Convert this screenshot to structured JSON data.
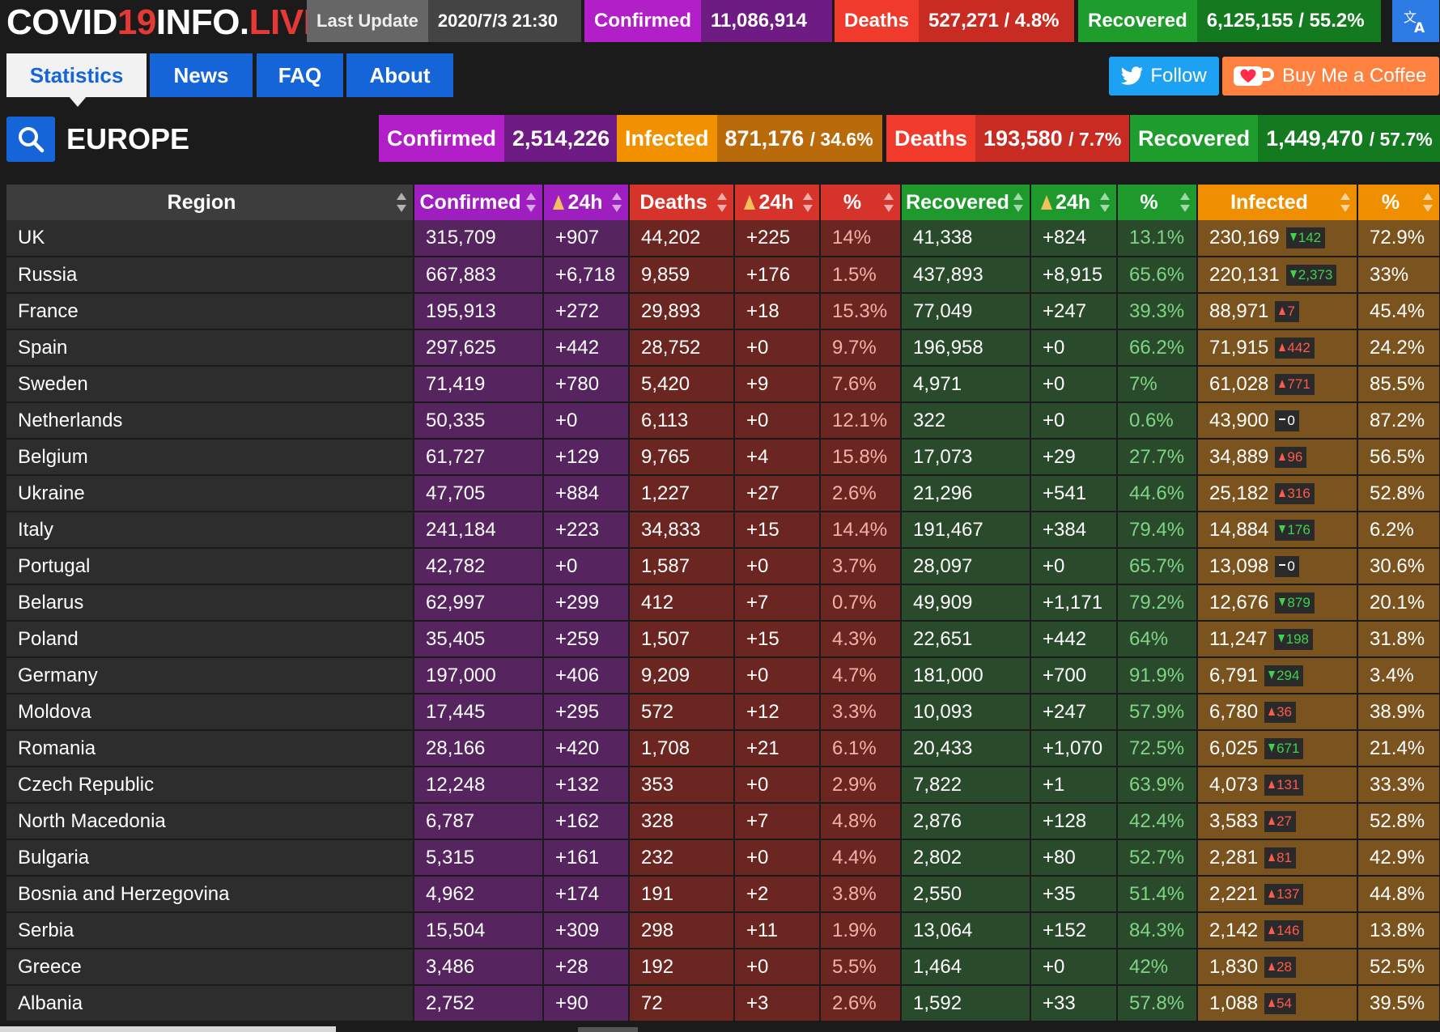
{
  "header": {
    "logo": {
      "part1": "COVID",
      "part2": "19",
      "part3": "INFO.",
      "part4": "LIVE"
    },
    "last_update": {
      "label": "Last Update",
      "value": "2020/7/3 21:30"
    },
    "confirmed": {
      "label": "Confirmed",
      "value": "11,086,914"
    },
    "deaths": {
      "label": "Deaths",
      "value": "527,271",
      "pct": "/ 4.8%"
    },
    "recovered": {
      "label": "Recovered",
      "value": "6,125,155",
      "pct": "/ 55.2%"
    },
    "language_icon": "translate-icon"
  },
  "nav": {
    "tabs": [
      {
        "label": "Statistics",
        "active": true
      },
      {
        "label": "News",
        "active": false
      },
      {
        "label": "FAQ",
        "active": false
      },
      {
        "label": "About",
        "active": false
      }
    ],
    "follow_label": "Follow",
    "coffee_label": "Buy Me a Coffee"
  },
  "region": {
    "name": "EUROPE",
    "confirmed": {
      "label": "Confirmed",
      "value": "2,514,226"
    },
    "infected": {
      "label": "Infected",
      "value": "871,176",
      "pct": "/ 34.6%"
    },
    "deaths": {
      "label": "Deaths",
      "value": "193,580",
      "pct": "/ 7.7%"
    },
    "recovered": {
      "label": "Recovered",
      "value": "1,449,470",
      "pct": "/ 57.7%"
    }
  },
  "table": {
    "columns": [
      "Region",
      "Confirmed",
      "24h",
      "Deaths",
      "24h",
      "%",
      "Recovered",
      "24h",
      "%",
      "Infected",
      "%"
    ],
    "rows": [
      [
        "UK",
        "315,709",
        "+907",
        "44,202",
        "+225",
        "14%",
        "41,338",
        "+824",
        "13.1%",
        "230,169",
        "down",
        "142",
        "72.9%"
      ],
      [
        "Russia",
        "667,883",
        "+6,718",
        "9,859",
        "+176",
        "1.5%",
        "437,893",
        "+8,915",
        "65.6%",
        "220,131",
        "down",
        "2,373",
        "33%"
      ],
      [
        "France",
        "195,913",
        "+272",
        "29,893",
        "+18",
        "15.3%",
        "77,049",
        "+247",
        "39.3%",
        "88,971",
        "up",
        "7",
        "45.4%"
      ],
      [
        "Spain",
        "297,625",
        "+442",
        "28,752",
        "+0",
        "9.7%",
        "196,958",
        "+0",
        "66.2%",
        "71,915",
        "up",
        "442",
        "24.2%"
      ],
      [
        "Sweden",
        "71,419",
        "+780",
        "5,420",
        "+9",
        "7.6%",
        "4,971",
        "+0",
        "7%",
        "61,028",
        "up",
        "771",
        "85.5%"
      ],
      [
        "Netherlands",
        "50,335",
        "+0",
        "6,113",
        "+0",
        "12.1%",
        "322",
        "+0",
        "0.6%",
        "43,900",
        "flat",
        "0",
        "87.2%"
      ],
      [
        "Belgium",
        "61,727",
        "+129",
        "9,765",
        "+4",
        "15.8%",
        "17,073",
        "+29",
        "27.7%",
        "34,889",
        "up",
        "96",
        "56.5%"
      ],
      [
        "Ukraine",
        "47,705",
        "+884",
        "1,227",
        "+27",
        "2.6%",
        "21,296",
        "+541",
        "44.6%",
        "25,182",
        "up",
        "316",
        "52.8%"
      ],
      [
        "Italy",
        "241,184",
        "+223",
        "34,833",
        "+15",
        "14.4%",
        "191,467",
        "+384",
        "79.4%",
        "14,884",
        "down",
        "176",
        "6.2%"
      ],
      [
        "Portugal",
        "42,782",
        "+0",
        "1,587",
        "+0",
        "3.7%",
        "28,097",
        "+0",
        "65.7%",
        "13,098",
        "flat",
        "0",
        "30.6%"
      ],
      [
        "Belarus",
        "62,997",
        "+299",
        "412",
        "+7",
        "0.7%",
        "49,909",
        "+1,171",
        "79.2%",
        "12,676",
        "down",
        "879",
        "20.1%"
      ],
      [
        "Poland",
        "35,405",
        "+259",
        "1,507",
        "+15",
        "4.3%",
        "22,651",
        "+442",
        "64%",
        "11,247",
        "down",
        "198",
        "31.8%"
      ],
      [
        "Germany",
        "197,000",
        "+406",
        "9,209",
        "+0",
        "4.7%",
        "181,000",
        "+700",
        "91.9%",
        "6,791",
        "down",
        "294",
        "3.4%"
      ],
      [
        "Moldova",
        "17,445",
        "+295",
        "572",
        "+12",
        "3.3%",
        "10,093",
        "+247",
        "57.9%",
        "6,780",
        "up",
        "36",
        "38.9%"
      ],
      [
        "Romania",
        "28,166",
        "+420",
        "1,708",
        "+21",
        "6.1%",
        "20,433",
        "+1,070",
        "72.5%",
        "6,025",
        "down",
        "671",
        "21.4%"
      ],
      [
        "Czech Republic",
        "12,248",
        "+132",
        "353",
        "+0",
        "2.9%",
        "7,822",
        "+1",
        "63.9%",
        "4,073",
        "up",
        "131",
        "33.3%"
      ],
      [
        "North Macedonia",
        "6,787",
        "+162",
        "328",
        "+7",
        "4.8%",
        "2,876",
        "+128",
        "42.4%",
        "3,583",
        "up",
        "27",
        "52.8%"
      ],
      [
        "Bulgaria",
        "5,315",
        "+161",
        "232",
        "+0",
        "4.4%",
        "2,802",
        "+80",
        "52.7%",
        "2,281",
        "up",
        "81",
        "42.9%"
      ],
      [
        "Bosnia and Herzegovina",
        "4,962",
        "+174",
        "191",
        "+2",
        "3.8%",
        "2,550",
        "+35",
        "51.4%",
        "2,221",
        "up",
        "137",
        "44.8%"
      ],
      [
        "Serbia",
        "15,504",
        "+309",
        "298",
        "+11",
        "1.9%",
        "13,064",
        "+152",
        "84.3%",
        "2,142",
        "up",
        "146",
        "13.8%"
      ],
      [
        "Greece",
        "3,486",
        "+28",
        "192",
        "+0",
        "5.5%",
        "1,464",
        "+0",
        "42%",
        "1,830",
        "up",
        "28",
        "52.5%"
      ],
      [
        "Albania",
        "2,752",
        "+90",
        "72",
        "+3",
        "2.6%",
        "1,592",
        "+33",
        "57.8%",
        "1,088",
        "up",
        "54",
        "39.5%"
      ]
    ]
  }
}
